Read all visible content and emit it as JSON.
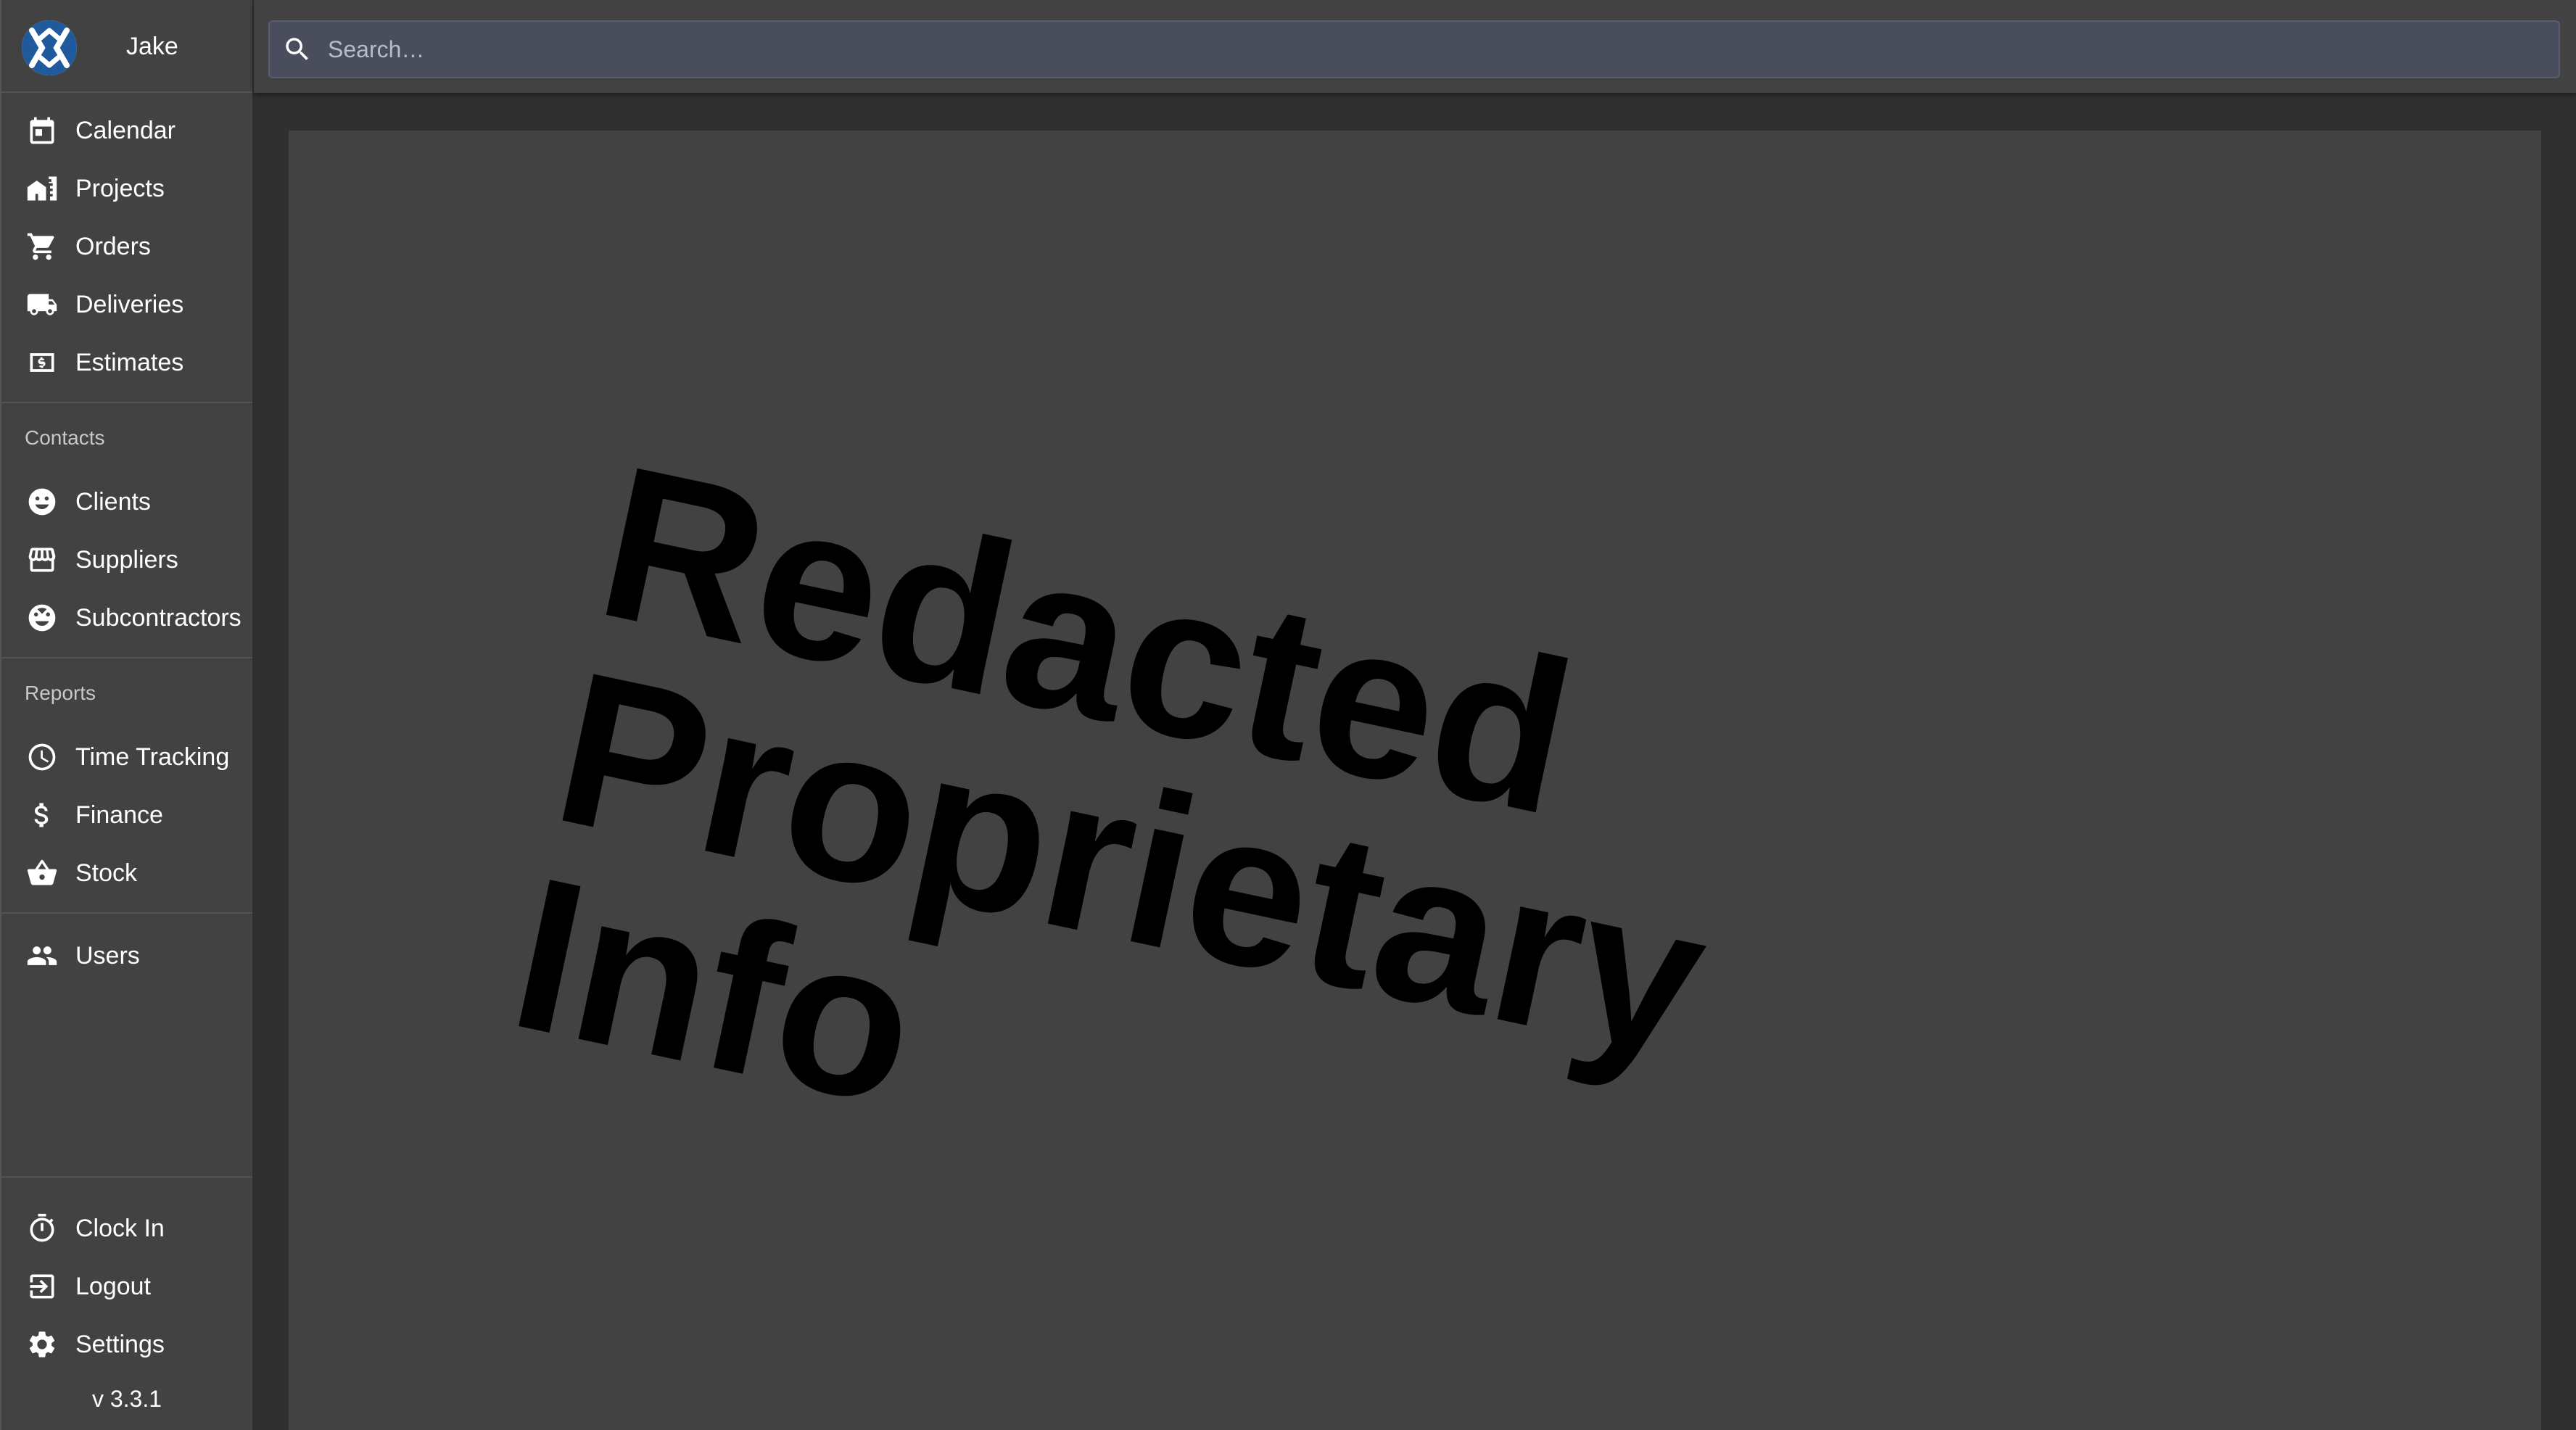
{
  "user": {
    "name": "Jake"
  },
  "search": {
    "placeholder": "Search…"
  },
  "nav_main": [
    {
      "label": "Calendar",
      "icon": "calendar-icon"
    },
    {
      "label": "Projects",
      "icon": "projects-icon"
    },
    {
      "label": "Orders",
      "icon": "cart-icon"
    },
    {
      "label": "Deliveries",
      "icon": "truck-icon"
    },
    {
      "label": "Estimates",
      "icon": "estimate-icon"
    }
  ],
  "contacts": {
    "heading": "Contacts",
    "items": [
      {
        "label": "Clients",
        "icon": "smiley-icon"
      },
      {
        "label": "Suppliers",
        "icon": "store-icon"
      },
      {
        "label": "Subcontractors",
        "icon": "worker-icon"
      }
    ]
  },
  "reports": {
    "heading": "Reports",
    "items": [
      {
        "label": "Time Tracking",
        "icon": "clock-icon"
      },
      {
        "label": "Finance",
        "icon": "dollar-icon"
      },
      {
        "label": "Stock",
        "icon": "basket-icon"
      }
    ]
  },
  "users": {
    "label": "Users",
    "icon": "people-icon"
  },
  "bottom": [
    {
      "label": "Clock In",
      "icon": "timer-icon"
    },
    {
      "label": "Logout",
      "icon": "logout-icon"
    },
    {
      "label": "Settings",
      "icon": "gear-icon"
    }
  ],
  "version": "v 3.3.1",
  "watermark": {
    "line1": "Redacted",
    "line2": "Proprietary Info"
  },
  "colors": {
    "sidebar_bg": "#424242",
    "page_bg": "#303030",
    "search_bg": "#4a4e5c",
    "logo_blue": "#1e5a9c"
  }
}
